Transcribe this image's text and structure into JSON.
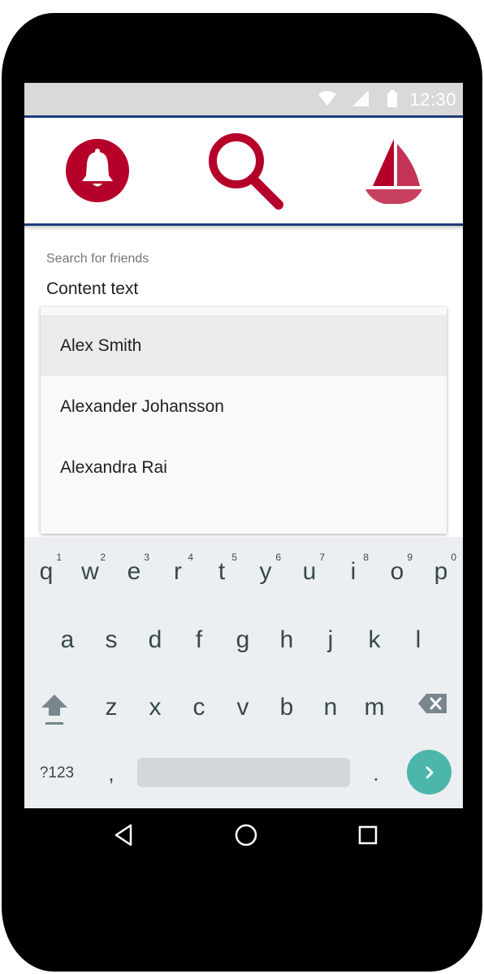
{
  "status_bar": {
    "time": "12:30",
    "icons": [
      "wifi-icon",
      "signal-icon",
      "battery-icon"
    ]
  },
  "app_bar": {
    "items": [
      {
        "icon": "bell-icon"
      },
      {
        "icon": "search-icon"
      },
      {
        "icon": "sailboat-icon"
      }
    ],
    "accent_color": "#b5002a",
    "border_color": "#1f3a7a"
  },
  "search": {
    "label": "Search for friends",
    "value": "Content text"
  },
  "suggestions": [
    {
      "label": "Alex Smith",
      "highlighted": true
    },
    {
      "label": "Alexander Johansson",
      "highlighted": false
    },
    {
      "label": "Alexandra Rai",
      "highlighted": false
    }
  ],
  "keyboard": {
    "row1": [
      {
        "letter": "q",
        "num": "1"
      },
      {
        "letter": "w",
        "num": "2"
      },
      {
        "letter": "e",
        "num": "3"
      },
      {
        "letter": "r",
        "num": "4"
      },
      {
        "letter": "t",
        "num": "5"
      },
      {
        "letter": "y",
        "num": "6"
      },
      {
        "letter": "u",
        "num": "7"
      },
      {
        "letter": "i",
        "num": "8"
      },
      {
        "letter": "o",
        "num": "9"
      },
      {
        "letter": "p",
        "num": "0"
      }
    ],
    "row2": [
      "a",
      "s",
      "d",
      "f",
      "g",
      "h",
      "j",
      "k",
      "l"
    ],
    "row3": [
      "z",
      "x",
      "c",
      "v",
      "b",
      "n",
      "m"
    ],
    "symbols_label": "?123",
    "comma": ",",
    "period": ".",
    "shift_icon": "shift-icon",
    "backspace_icon": "backspace-icon",
    "go_icon": "chevron-right-icon",
    "go_color": "#4db6ac"
  },
  "system_nav": [
    "back-icon",
    "home-icon",
    "recents-icon"
  ]
}
